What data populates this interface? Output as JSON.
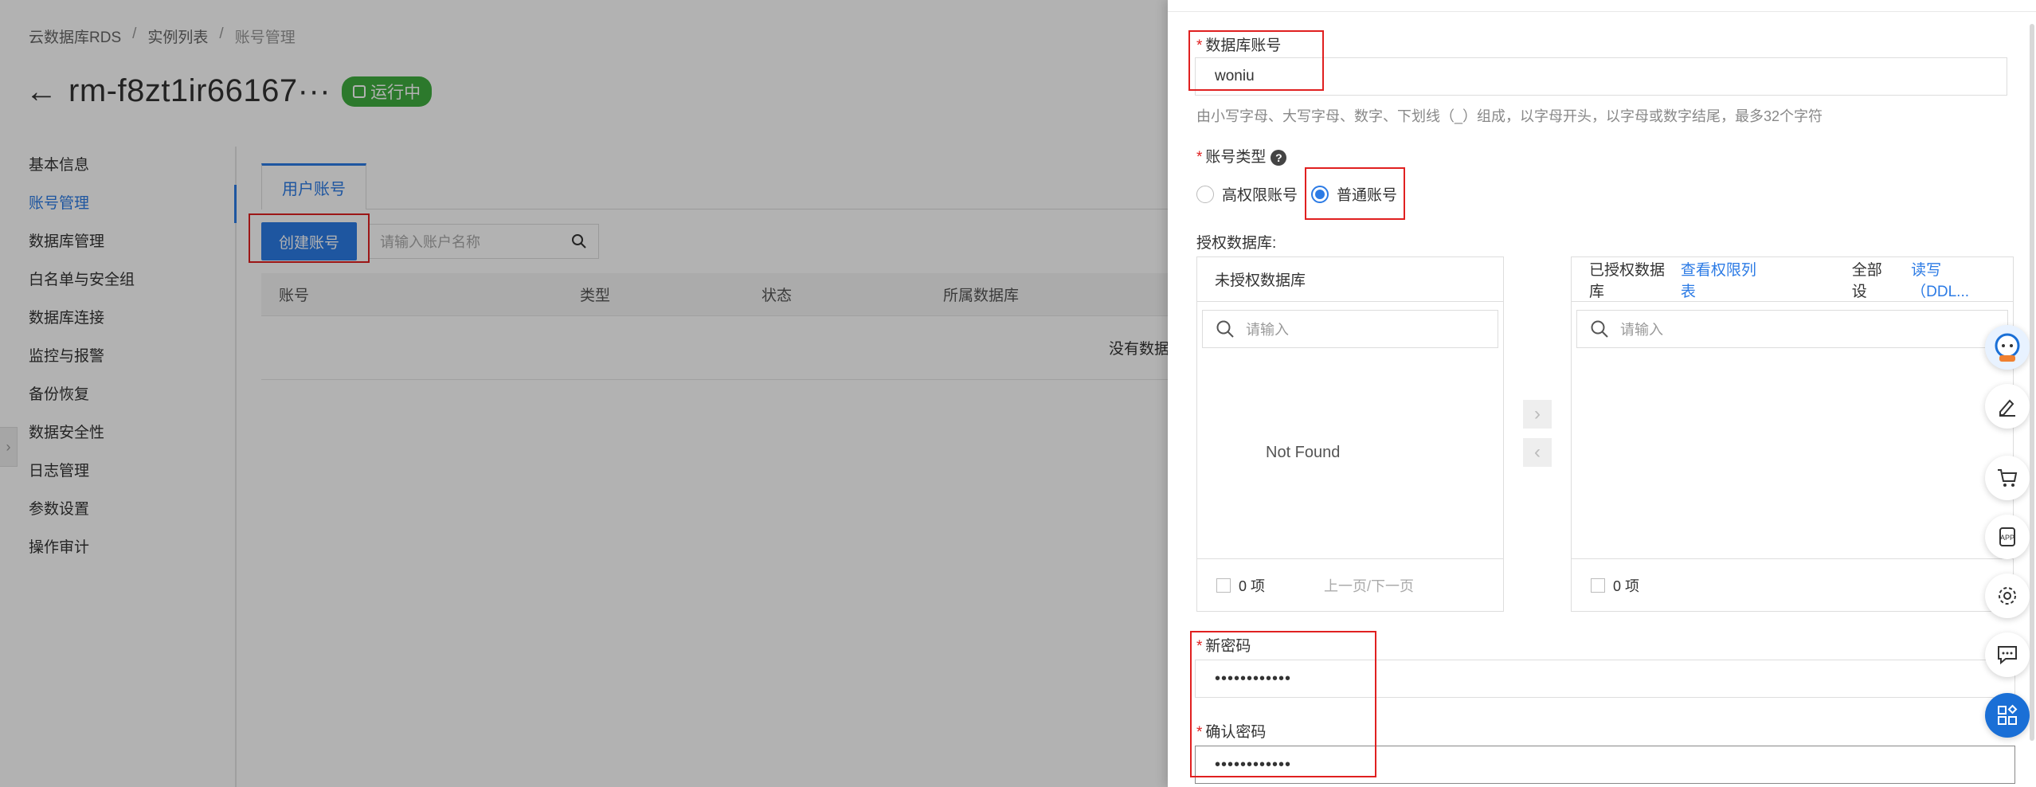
{
  "breadcrumb": [
    "云数据库RDS",
    "实例列表",
    "账号管理"
  ],
  "instance": {
    "title": "rm-f8zt1ir66167···",
    "status": "运行中"
  },
  "sidebar": {
    "items": [
      "基本信息",
      "账号管理",
      "数据库管理",
      "白名单与安全组",
      "数据库连接",
      "监控与报警",
      "备份恢复",
      "数据安全性",
      "日志管理",
      "参数设置",
      "操作审计"
    ],
    "active_index": 1
  },
  "main": {
    "tab": "用户账号",
    "create_button": "创建账号",
    "search_placeholder": "请输入账户名称",
    "columns": [
      "账号",
      "类型",
      "状态",
      "所属数据库"
    ],
    "empty_text": "没有数据"
  },
  "drawer": {
    "account_label": "数据库账号",
    "account_value": "woniu",
    "account_hint": "由小写字母、大写字母、数字、下划线（_）组成，以字母开头，以字母或数字结尾，最多32个字符",
    "type_label": "账号类型",
    "type_options": [
      "高权限账号",
      "普通账号"
    ],
    "type_selected": "普通账号",
    "auth_db_label": "授权数据库:",
    "left_panel": {
      "title": "未授权数据库",
      "search_placeholder": "请输入",
      "empty": "Not Found",
      "count": "0 项",
      "pager": [
        "上一页",
        "/",
        "下一页"
      ]
    },
    "right_panel": {
      "title": "已授权数据库",
      "link": "查看权限列表",
      "set_all": "全部设",
      "perm": "读写（DDL...",
      "search_placeholder": "请输入",
      "count": "0 项"
    },
    "new_password_label": "新密码",
    "new_password_value": "••••••••••••",
    "confirm_password_label": "确认密码",
    "confirm_password_value": "••••••••••••"
  },
  "colors": {
    "accent": "#2c7be5",
    "status": "#3fae3f",
    "highlight": "#e02020"
  }
}
